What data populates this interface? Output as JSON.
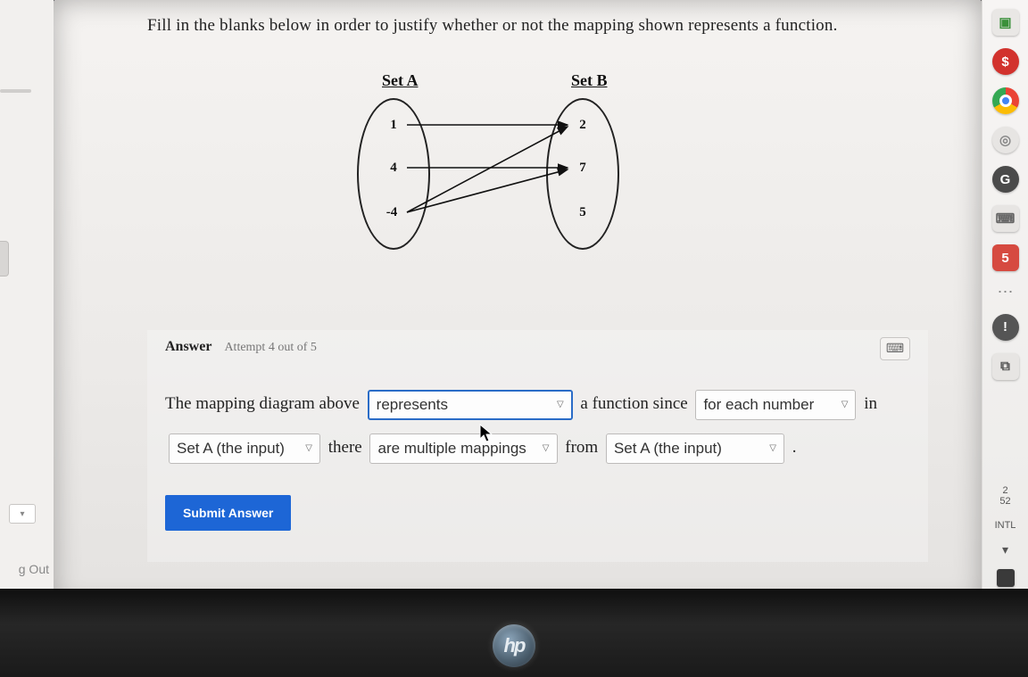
{
  "prompt": "Fill in the blanks below in order to justify whether or not the mapping shown represents a function.",
  "diagram": {
    "setA_label": "Set A",
    "setB_label": "Set B",
    "setA_values": [
      "1",
      "4",
      "-4"
    ],
    "setB_values": [
      "2",
      "7",
      "5"
    ],
    "mappings": [
      {
        "from": "1",
        "to": "2"
      },
      {
        "from": "4",
        "to": "7"
      },
      {
        "from": "-4",
        "to": "2"
      },
      {
        "from": "-4",
        "to": "7"
      }
    ]
  },
  "answer": {
    "label": "Answer",
    "attempt": "Attempt 4 out of 5",
    "sentence": {
      "t1": "The mapping diagram above",
      "dd1": "represents",
      "t2": "a function since",
      "dd2": "for each number",
      "t3": "in",
      "dd3": "Set A (the input)",
      "t4": "there",
      "dd4": "are multiple mappings",
      "t5": "from",
      "dd5": "Set A (the input)",
      "t6": "."
    },
    "submit": "Submit Answer"
  },
  "left": {
    "logout": "g Out"
  },
  "rail": {
    "items": [
      {
        "kind": "square",
        "bg": "#e9e7e5",
        "fg": "#3a903a",
        "glyph": "▣"
      },
      {
        "kind": "circle",
        "bg": "#d2322d",
        "fg": "#ffffff",
        "glyph": "$"
      },
      {
        "kind": "chrome"
      },
      {
        "kind": "circle",
        "bg": "#e7e5e3",
        "fg": "#888",
        "glyph": "◎"
      },
      {
        "kind": "circle",
        "bg": "#4a4a4a",
        "fg": "#fff",
        "glyph": "G"
      },
      {
        "kind": "square",
        "bg": "#e7e5e3",
        "fg": "#666",
        "glyph": "⌨"
      },
      {
        "kind": "square",
        "bg": "#d64a40",
        "fg": "#fff",
        "glyph": "5"
      },
      {
        "kind": "dots"
      },
      {
        "kind": "circle",
        "bg": "#555",
        "fg": "#fff",
        "glyph": "!"
      },
      {
        "kind": "square",
        "bg": "#e7e5e3",
        "fg": "#555",
        "glyph": "⧉"
      }
    ],
    "clock": {
      "line1": "2",
      "line2": "52"
    },
    "lang": "INTL",
    "wifi": "▾"
  },
  "logo": "hp",
  "colors": {
    "primary": "#1d66d6",
    "select_border": "#2a6cc7"
  }
}
